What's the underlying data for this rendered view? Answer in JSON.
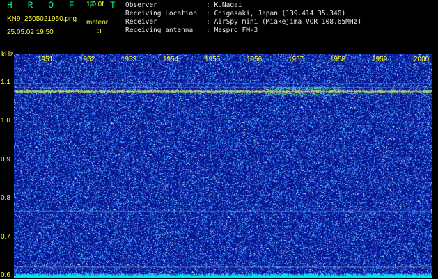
{
  "header": {
    "title": "H R O F F T",
    "version": "1.0.0f",
    "file_name": "KN9_2505021950.png",
    "meteor_label": "meteor",
    "datetime": "25.05.02 19:50",
    "meteor_count": "3",
    "info": [
      {
        "key": "Observer",
        "value": ": K.Nagai"
      },
      {
        "key": "Receiving Location",
        "value": ": Chigasaki, Japan (139.414 35.340)"
      },
      {
        "key": "Receiver",
        "value": ": AirSpy mini (Miakejima VOR 108.65MHz)"
      },
      {
        "key": "Receiving antenna",
        "value": ": Maspro FM-3"
      }
    ]
  },
  "spectrogram": {
    "y_unit": "kHz",
    "y_ticks": [
      "1.1",
      "1.0",
      "0.9",
      "0.8",
      "0.7",
      "0.6"
    ],
    "y_range": [
      0.595,
      1.175
    ],
    "x_ticks": [
      "1951",
      "1952",
      "1953",
      "1954",
      "1955",
      "1956",
      "1957",
      "1958",
      "1959",
      "2000"
    ],
    "carrier_khz": 1.079,
    "reference_lines_khz": [
      1.1,
      1.09,
      1.0,
      0.77,
      0.625,
      0.605
    ],
    "colors": {
      "background": "#0a1a8a",
      "noise": "#3a6aff",
      "carrier": "#ff7a30",
      "baseline": "#00e5ff"
    }
  }
}
